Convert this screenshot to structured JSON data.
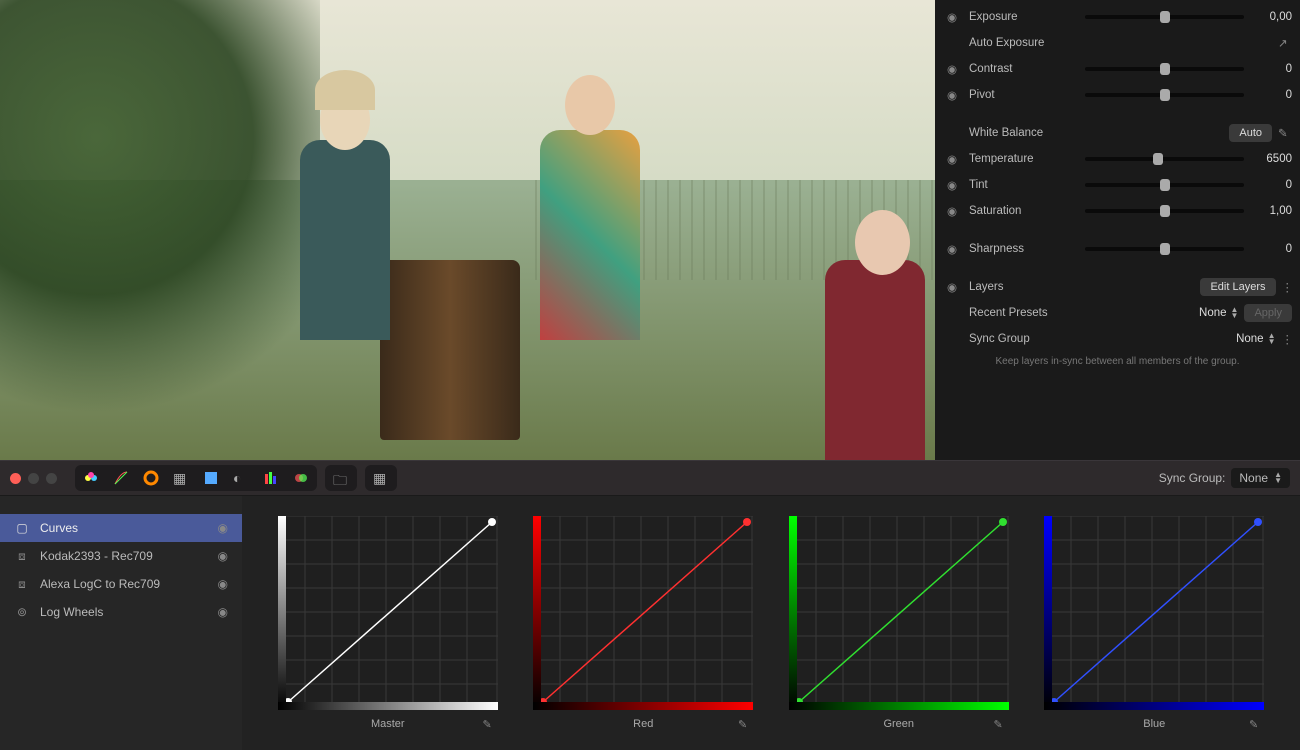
{
  "inspector": {
    "exposure_label": "Exposure",
    "exposure_value": "0,00",
    "auto_exposure_label": "Auto Exposure",
    "contrast_label": "Contrast",
    "contrast_value": "0",
    "pivot_label": "Pivot",
    "pivot_value": "0",
    "wb_label": "White Balance",
    "wb_auto": "Auto",
    "temperature_label": "Temperature",
    "temperature_value": "6500",
    "tint_label": "Tint",
    "tint_value": "0",
    "saturation_label": "Saturation",
    "saturation_value": "1,00",
    "sharpness_label": "Sharpness",
    "sharpness_value": "0",
    "layers_label": "Layers",
    "edit_layers": "Edit Layers",
    "recent_presets_label": "Recent Presets",
    "recent_presets_value": "None",
    "apply_label": "Apply",
    "sync_group_label": "Sync Group",
    "sync_group_value": "None",
    "sync_hint": "Keep layers in-sync between all members of the group."
  },
  "toolbar": {
    "sync_group_label": "Sync Group:",
    "sync_group_value": "None"
  },
  "layers_list": [
    {
      "name": "Curves",
      "icon": "curves",
      "active": true
    },
    {
      "name": "Kodak2393 - Rec709",
      "icon": "cube",
      "active": false
    },
    {
      "name": "Alexa LogC to Rec709",
      "icon": "cube",
      "active": false
    },
    {
      "name": "Log Wheels",
      "icon": "wheels",
      "active": false
    }
  ],
  "curves": {
    "master_label": "Master",
    "red_label": "Red",
    "green_label": "Green",
    "blue_label": "Blue",
    "colors": {
      "master": "#ffffff",
      "red": "#ff3030",
      "green": "#30e030",
      "blue": "#3050ff"
    }
  },
  "chart_data": [
    {
      "type": "line",
      "title": "Master",
      "x": [
        0,
        1
      ],
      "y": [
        0,
        1
      ],
      "xlim": [
        0,
        1
      ],
      "ylim": [
        0,
        1
      ],
      "color": "#ffffff"
    },
    {
      "type": "line",
      "title": "Red",
      "x": [
        0,
        1
      ],
      "y": [
        0,
        1
      ],
      "xlim": [
        0,
        1
      ],
      "ylim": [
        0,
        1
      ],
      "color": "#ff3030"
    },
    {
      "type": "line",
      "title": "Green",
      "x": [
        0,
        1
      ],
      "y": [
        0,
        1
      ],
      "xlim": [
        0,
        1
      ],
      "ylim": [
        0,
        1
      ],
      "color": "#30e030"
    },
    {
      "type": "line",
      "title": "Blue",
      "x": [
        0,
        1
      ],
      "y": [
        0,
        1
      ],
      "xlim": [
        0,
        1
      ],
      "ylim": [
        0,
        1
      ],
      "color": "#3050ff"
    }
  ]
}
